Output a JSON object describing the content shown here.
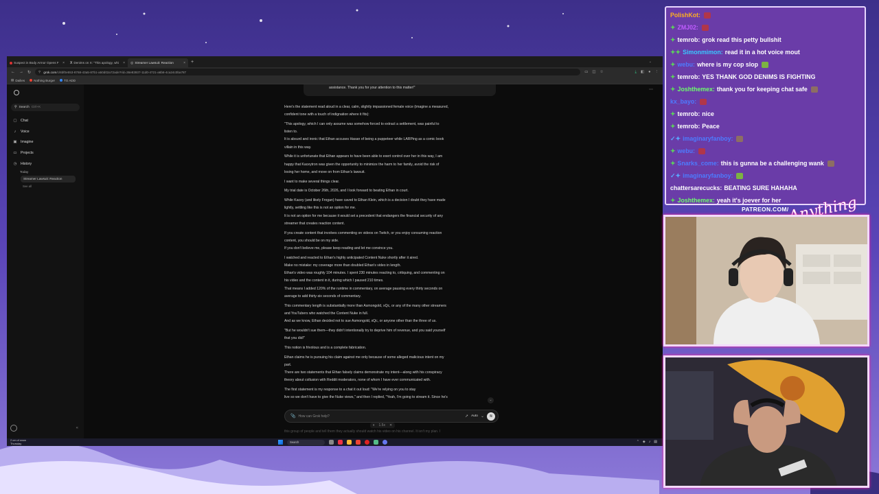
{
  "browser": {
    "tabs": [
      {
        "title": "Suspect in Body Armor Opens F",
        "active": false
      },
      {
        "title": "Denims on X: \"This apology, whi",
        "active": false
      },
      {
        "title": "Streamer Lawsuit: Reaction",
        "active": true
      }
    ],
    "url_domain": "grok.com",
    "url_path": "/c/6bf0e553-8768-43a5-87b1-a50d02a72ade?rid=36e83937-11d0-4721-a6b6-4ca24c0ba787",
    "bookmarks": [
      "Dailies",
      "Nothing Burger",
      "TO ADD"
    ]
  },
  "sidebar": {
    "search_label": "Search",
    "search_shortcut": "Ctrl+K",
    "items": [
      {
        "label": "Chat",
        "icon": "chat-icon"
      },
      {
        "label": "Voice",
        "icon": "voice-icon"
      },
      {
        "label": "Imagine",
        "icon": "image-icon"
      },
      {
        "label": "Projects",
        "icon": "folder-icon"
      },
      {
        "label": "History",
        "icon": "clock-icon"
      }
    ],
    "today_label": "Today",
    "history_item": "Streamer Lawsuit: Reaction",
    "see_all": "See all"
  },
  "chat": {
    "prev_message_tail": "assistance. Thank you for your attention to this matter!\"",
    "paragraphs": [
      "Here's the statement read aloud in a clear, calm, slightly impassioned female voice (imagine a measured,",
      "confident tone with a touch of indignation where it fits):",
      "\"This apology, which I can only assume was somehow forced to extract a settlement, was painful to",
      "listen to.",
      "It is absurd and ironic that Ethan accuses Hasan of being a puppeteer while LARPing as a comic book",
      "villain in this way.",
      "While it is unfortunate that Ethan appears to have been able to exert control over her in this way, I am",
      "happy that Kaceytron was given the opportunity to minimize the harm to her family, avoid the risk of",
      "losing her home, and move on from Ethan's lawsuit.",
      "I want to make several things clear.",
      "My trial date is October 26th, 2026, and I look forward to beating Ethan in court.",
      "While Kacey (and likely Frogan) have caved to Ethan Klein, which is a decision I doubt they have made",
      "lightly, settling like this is not an option for me.",
      "It is not an option for me because it would set a precedent that endangers the financial security of any",
      "streamer that creates reaction content.",
      "If you create content that involves commenting on videos on Twitch, or you enjoy consuming reaction",
      "content, you should be on my side.",
      "If you don't believe me, please keep reading and let me convince you.",
      "I watched and reacted to Ethan's highly anticipated Content Nuke shortly after it aired.",
      "Make no mistake: my coverage more than doubled Ethan's video in length.",
      "Ethan's video was roughly 104 minutes. I spent 230 minutes reacting to, critiquing, and commenting on",
      "his video and the content in it, during which I paused 210 times.",
      "That means I added 120% of the runtime in commentary, on average pausing every thirty seconds on",
      "average to add thirty-six seconds of commentary.",
      "This commentary length is substantially more than Asmongold, xQc, or any of the many other streamers",
      "and YouTubers who watched the Content Nuke in full.",
      "And as we know, Ethan decided not to sue Asmongold, xQc, or anyone other than the three of us.",
      "\"But he wouldn't sue them—they didn't intentionally try to deprive him of revenue, and you said yourself",
      "that you did!\"",
      "This notion is frivolous and is a complete fabrication.",
      "Ethan claims he is pursuing his claim against me only because of some alleged malicious intent on my",
      "part.",
      "There are two statements that Ethan falsely claims demonstrate my intent—along with his conspiracy",
      "theory about collusion with Reddit moderators, none of whom I have ever communicated with.",
      "The first statement is my response to a chat                    it out loud: \"We're relying on you to stay",
      "live so we don't have to give the Nuke views,\" and then I replied, \"Yeah, I'm going to stream it. Since he's"
    ],
    "spaced_indices": [
      2,
      6,
      9,
      10,
      11,
      15,
      18,
      24,
      27,
      29,
      30,
      34
    ],
    "pager": {
      "prev": "⏸",
      "speed": "1.5x",
      "close": "✕"
    },
    "composer_placeholder": "How can Grok help?",
    "model_label": "Auto",
    "below_fold": "this group of people and tell them they actually should watch his video on his channel. It isn't my plan. I"
  },
  "taskbar": {
    "weather_temp": "2 cm of snow",
    "weather_day": "Thursday",
    "search_label": "Search"
  },
  "stream_chat": {
    "messages": [
      {
        "user": "PolishKot:",
        "user_color": "#ffb020",
        "badge": "",
        "text": "",
        "emote": "red"
      },
      {
        "user": "ZMJ02:",
        "user_color": "#c05cff",
        "badge": "✦",
        "text": "",
        "emote": "red"
      },
      {
        "user": "temrob:",
        "user_color": "#ffffff",
        "badge": "✦",
        "text": "grok read this petty bullshit",
        "emote": ""
      },
      {
        "user": "Simonmimon:",
        "user_color": "#39c7ff",
        "badge": "✦✦",
        "text": "read it in a hot voice mout",
        "emote": ""
      },
      {
        "user": "webu:",
        "user_color": "#4d7cff",
        "badge": "✦",
        "text": "where is my cop slop",
        "emote": "green"
      },
      {
        "user": "temrob:",
        "user_color": "#ffffff",
        "badge": "✦",
        "text": "YES THANK GOD DENIMS IS FIGHTING",
        "emote": ""
      },
      {
        "user": "Joshthemex:",
        "user_color": "#6cff6c",
        "badge": "✦",
        "text": "thank you for keeping chat safe",
        "emote": "brown"
      },
      {
        "user": "kx_bayo:",
        "user_color": "#4d7cff",
        "badge": "",
        "text": "",
        "emote": "red"
      },
      {
        "user": "temrob:",
        "user_color": "#ffffff",
        "badge": "✦",
        "text": "nice",
        "emote": ""
      },
      {
        "user": "temrob:",
        "user_color": "#ffffff",
        "badge": "✦",
        "text": "Peace",
        "emote": ""
      },
      {
        "user": "imaginaryfanboy:",
        "user_color": "#4d7cff",
        "badge": "✓✦",
        "text": "",
        "emote": "brown"
      },
      {
        "user": "webu:",
        "user_color": "#4d7cff",
        "badge": "✦",
        "text": "",
        "emote": "red"
      },
      {
        "user": "Snarks_come:",
        "user_color": "#4d7cff",
        "badge": "✦",
        "text": "this is gunna be a challenging wank",
        "emote": "brown"
      },
      {
        "user": "imaginaryfanboy:",
        "user_color": "#4d7cff",
        "badge": "✓✦",
        "text": "",
        "emote": "green"
      },
      {
        "user": "chattersarecucks:",
        "user_color": "#ffffff",
        "badge": "",
        "text": "BEATING SURE HAHAHA",
        "emote": ""
      },
      {
        "user": "Joshthemex:",
        "user_color": "#6cff6c",
        "badge": "✦",
        "text": "yeah it's joever for her",
        "emote": ""
      }
    ]
  },
  "overlay": {
    "patreon": "PATREON.COM/",
    "signature": "Anything Else?"
  },
  "colors": {
    "background_purple": "#4f3fa6",
    "chat_panel": "#6a3ca8",
    "frame_border": "#f3d9ff"
  }
}
